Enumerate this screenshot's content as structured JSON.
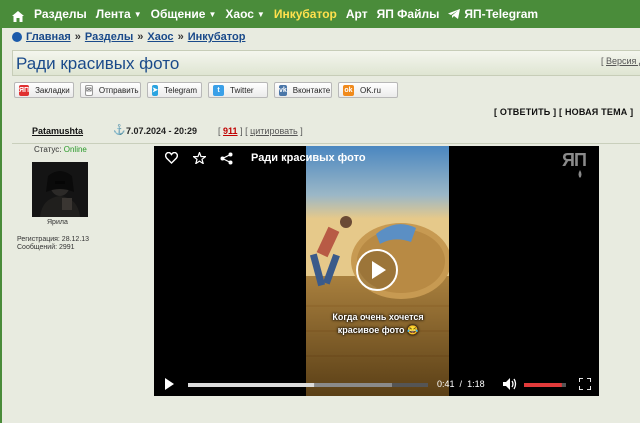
{
  "topnav": {
    "items": [
      {
        "label": "Разделы",
        "caret": false,
        "highlight": false
      },
      {
        "label": "Лента",
        "caret": true,
        "highlight": false
      },
      {
        "label": "Общение",
        "caret": true,
        "highlight": false
      },
      {
        "label": "Хаос",
        "caret": true,
        "highlight": false
      },
      {
        "label": "Инкубатор",
        "caret": false,
        "highlight": true
      },
      {
        "label": "Арт",
        "caret": false,
        "highlight": false
      },
      {
        "label": "ЯП Файлы",
        "caret": false,
        "highlight": false
      },
      {
        "label": "ЯП-Telegram",
        "caret": false,
        "highlight": false
      }
    ],
    "highlight_color": "#ffe14d"
  },
  "breadcrumb": [
    "Главная",
    "Разделы",
    "Хаос",
    "Инкубатор"
  ],
  "breadcrumb_sep": "»",
  "page": {
    "title": "Ради красивых фото",
    "version_link": "Версия д"
  },
  "share": {
    "buttons": [
      {
        "label": "Закладки",
        "icon": "yap-icon",
        "color": "#e03030",
        "glyph": "ЯП"
      },
      {
        "label": "Отправить",
        "icon": "mail-icon",
        "color": "#ffffff",
        "glyph": "✉"
      },
      {
        "label": "Telegram",
        "icon": "telegram-icon",
        "color": "#2aa3e0",
        "glyph": "➤"
      },
      {
        "label": "Twitter",
        "icon": "twitter-icon",
        "color": "#3aa0e8",
        "glyph": "t"
      },
      {
        "label": "Вконтакте",
        "icon": "vk-icon",
        "color": "#4a76a8",
        "glyph": "vk"
      },
      {
        "label": "OK.ru",
        "icon": "ok-icon",
        "color": "#f08a1c",
        "glyph": "ok"
      }
    ]
  },
  "thread_actions": {
    "reply": "[ ОТВЕТИТЬ ]",
    "new_topic": "[ НОВАЯ ТЕМА ]"
  },
  "post": {
    "author": "Patamushta",
    "anchor_glyph": "⚓",
    "date": "7.07.2024 - 20:29",
    "bracket_open": "[",
    "comment_count": "911",
    "bracket_sep": "] [",
    "cite": "цитировать",
    "bracket_close": "]"
  },
  "user": {
    "status_label": "Статус:",
    "status": "Online",
    "name": "Ярила",
    "registration": "Регистрация: 28.12.13",
    "messages": "Сообщений: 2991"
  },
  "video": {
    "title": "Ради красивых фото",
    "caption": "Когда очень хочется красивое фото 😂",
    "current_time": "0:41",
    "time_sep": "/",
    "duration": "1:18",
    "progress": 0.5256,
    "buffered": 0.85,
    "volume": 0.9,
    "logo": "ЯП"
  }
}
